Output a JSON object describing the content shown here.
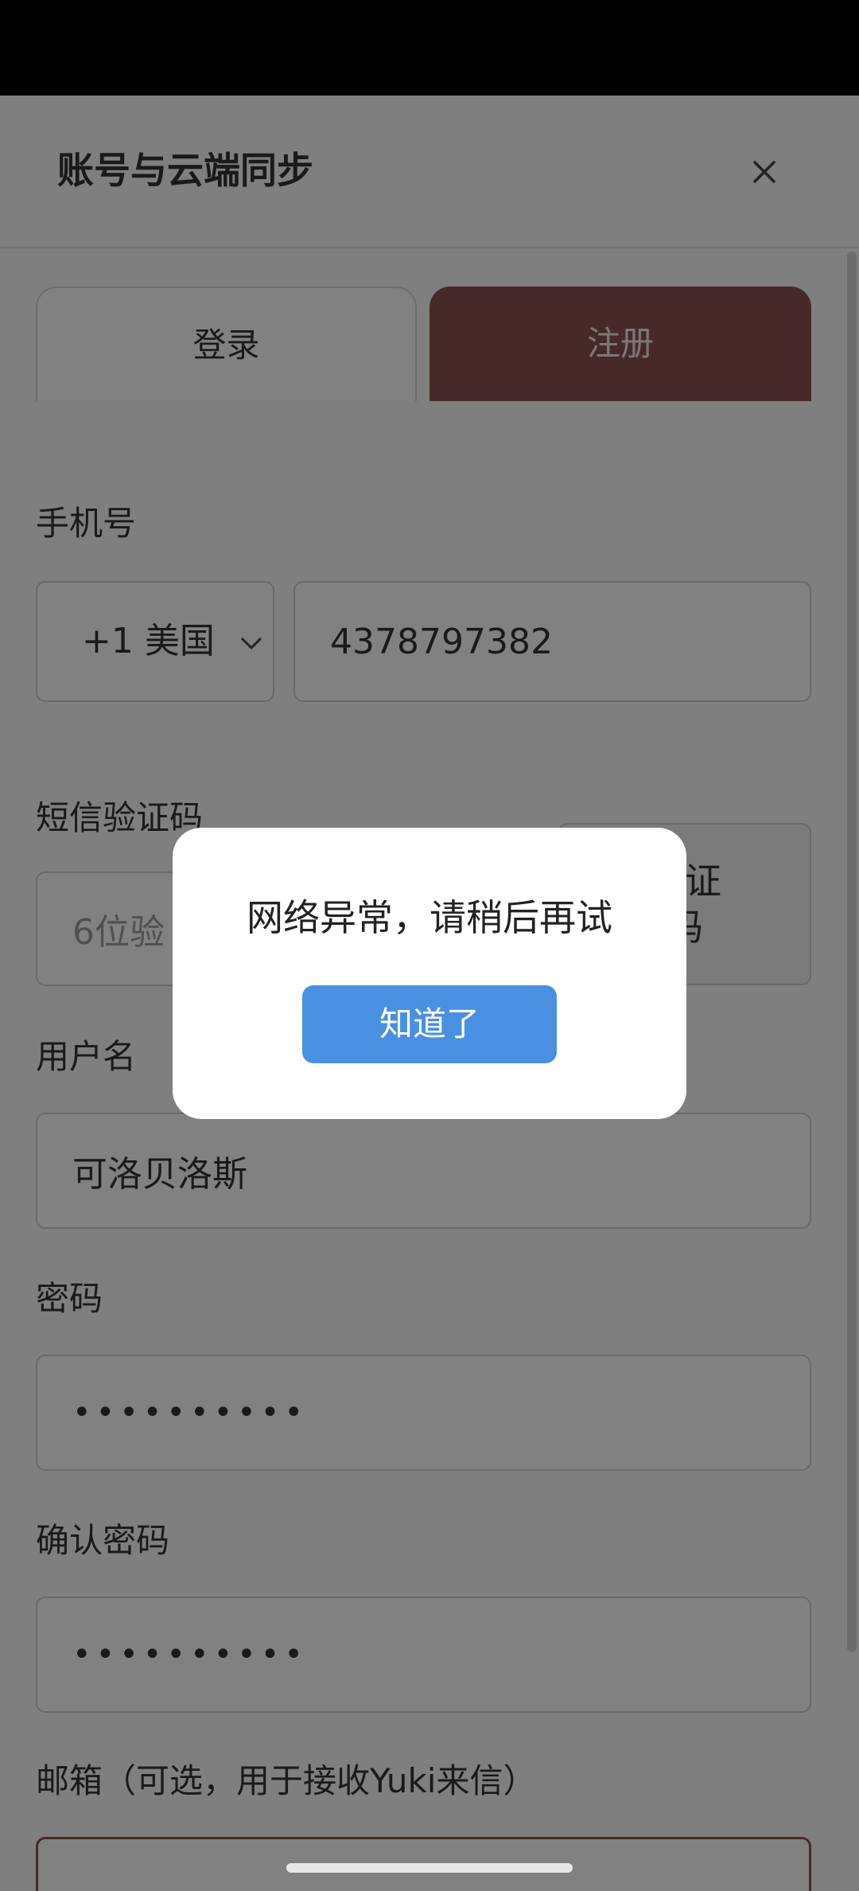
{
  "header": {
    "title": "账号与云端同步",
    "close_icon": "close-icon"
  },
  "tabs": {
    "login": "登录",
    "register": "注册",
    "active": "register"
  },
  "form": {
    "phone_label": "手机号",
    "country_code": "+1 美国",
    "phone_value": "4378797382",
    "sms_label": "短信验证码",
    "sms_placeholder": "6位验",
    "sms_button": "验证\n码",
    "username_label": "用户名",
    "username_value": "可洛贝洛斯",
    "password_label": "密码",
    "password_value": "••••••••••",
    "confirm_label": "确认密码",
    "confirm_value": "••••••••••",
    "email_label": "邮箱（可选，用于接收Yuki来信）"
  },
  "dialog": {
    "message": "网络异常，请稍后再试",
    "ok_label": "知道了"
  },
  "colors": {
    "accent_register": "#8b4f4f",
    "dialog_button": "#4a90e2",
    "overlay": "rgba(0,0,0,0.48)"
  }
}
